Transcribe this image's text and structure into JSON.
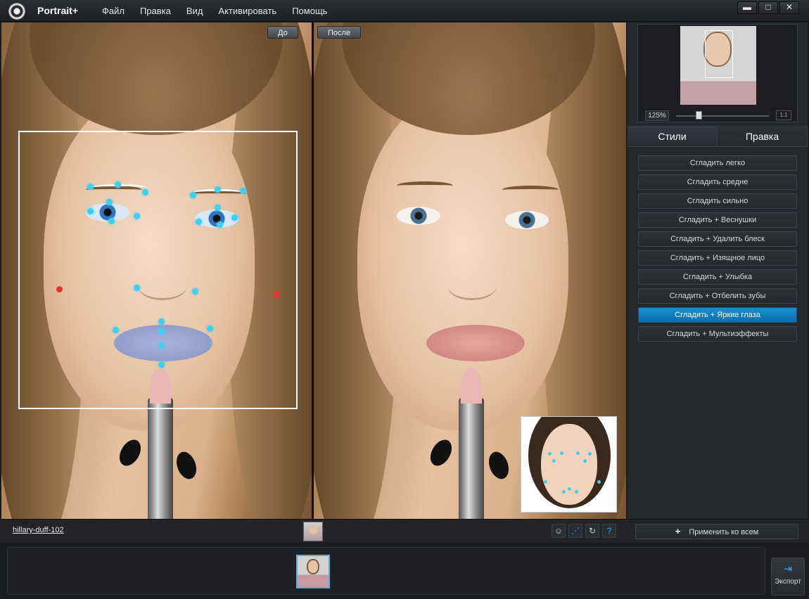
{
  "app": {
    "title": "Portrait+",
    "menu": [
      "Файл",
      "Правка",
      "Вид",
      "Активировать",
      "Помощь"
    ],
    "window_controls": {
      "minimize": "▬",
      "maximize": "□",
      "close": "✕"
    }
  },
  "viewer": {
    "before_label": "До",
    "after_label": "После"
  },
  "navigator": {
    "zoom": "125%",
    "fit_label": "1:1",
    "zoom_level_fraction": 0.24
  },
  "tabs": [
    {
      "label": "Стили",
      "active": true
    },
    {
      "label": "Правка",
      "active": false
    }
  ],
  "styles": [
    {
      "label": "Сгладить легко",
      "active": false
    },
    {
      "label": "Сгладить средне",
      "active": false
    },
    {
      "label": "Сгладить сильно",
      "active": false
    },
    {
      "label": "Сгладить + Веснушки",
      "active": false
    },
    {
      "label": "Сгладить + Удалить блеск",
      "active": false
    },
    {
      "label": "Сгладить + Изящное лицо",
      "active": false
    },
    {
      "label": "Сгладить + Улыбка",
      "active": false
    },
    {
      "label": "Сгладить + Отбелить зубы",
      "active": false
    },
    {
      "label": "Сгладить + Яркие глаза",
      "active": true
    },
    {
      "label": "Сгладить + Мультиэффекты",
      "active": false
    }
  ],
  "bottom": {
    "filename": "hillary-duff-102",
    "apply_all": "Применить ко всем",
    "apply_plus": "+",
    "help": "?",
    "export_label": "Экспорт",
    "export_icon": "⇥"
  },
  "colors": {
    "accent": "#1a8fd1",
    "point": "#3fd0f0",
    "point_alert": "#e8332a"
  }
}
